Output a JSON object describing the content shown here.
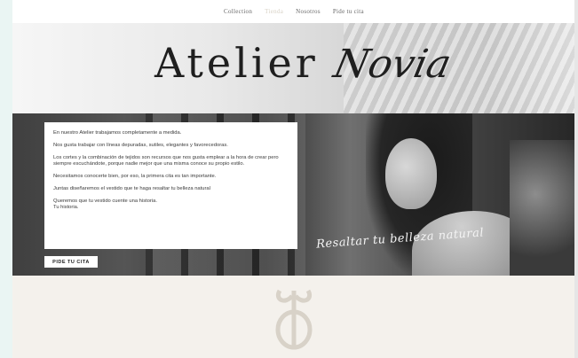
{
  "nav": {
    "items": [
      {
        "label": "Collection"
      },
      {
        "label": "Tienda"
      },
      {
        "label": "Nosotros"
      },
      {
        "label": "Pide tu cita"
      }
    ]
  },
  "hero": {
    "logo_word1": "Atelier",
    "logo_word2": "Novia"
  },
  "intro": {
    "paragraphs": [
      "En nuestro Atelier trabajamos completamente a medida.",
      "Nos gusta trabajar con líneas depuradas, sutiles, elegantes y favorecedoras.",
      "Los cortes y la combinación de tejidos son recursos que nos gusta emplear a la hora de crear pero siempre escuchándote, porque nadie mejor que una misma conoce su propio estilo.",
      "Necesitamos conocerte bien, por eso, la primera cita es tan importante.",
      "Juntas diseñaremos el vestido que te haga resaltar tu belleza natural",
      "Queremos que tu vestido cuente una historia.",
      "Tu historia."
    ],
    "cta_label": "PIDE TU CITA",
    "tagline": "Resaltar tu belleza natural"
  },
  "colors": {
    "background": "#f4f1ec",
    "nav_active": "#d9d2c6",
    "monogram": "#d8d2c8"
  },
  "icons": {
    "monogram": "atelier-monogram-icon"
  }
}
